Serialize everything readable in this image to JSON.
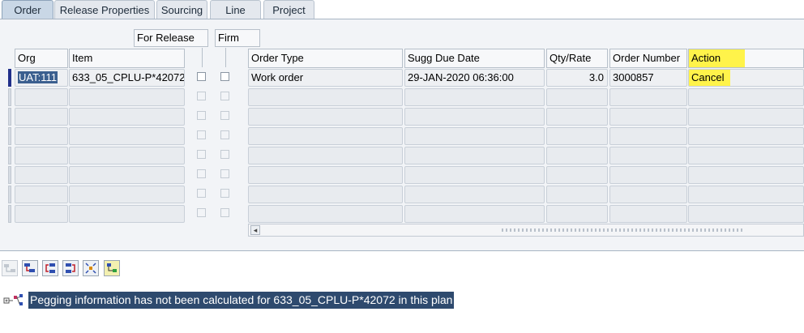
{
  "tabs": [
    "Order",
    "Release Properties",
    "Sourcing",
    "Line",
    "Project"
  ],
  "group_headers": {
    "for_release": "For Release",
    "firm": "Firm"
  },
  "columns": {
    "org": "Org",
    "item": "Item",
    "order_type": "Order Type",
    "sugg_due_date": "Sugg Due Date",
    "qty_rate": "Qty/Rate",
    "order_number": "Order Number",
    "action": "Action"
  },
  "rows": [
    {
      "org": "UAT:111",
      "item": "633_05_CPLU-P*42072",
      "order_type": "Work order",
      "sugg_due_date": "29-JAN-2020 06:36:00",
      "qty_rate": "3.0",
      "order_number": "3000857",
      "action": "Cancel"
    }
  ],
  "status": {
    "message": "Pegging information has not been calculated for 633_05_CPLU-P*42072 in this plan"
  },
  "toolbar_icons": [
    "pegging-up-icon",
    "pegging-down-icon",
    "pegging-left-icon",
    "pegging-right-icon",
    "expand-icon",
    "legend-icon"
  ],
  "colors": {
    "highlight": "#fff34a",
    "selection": "#3b5f8f",
    "current_row_marker": "#21308a"
  }
}
